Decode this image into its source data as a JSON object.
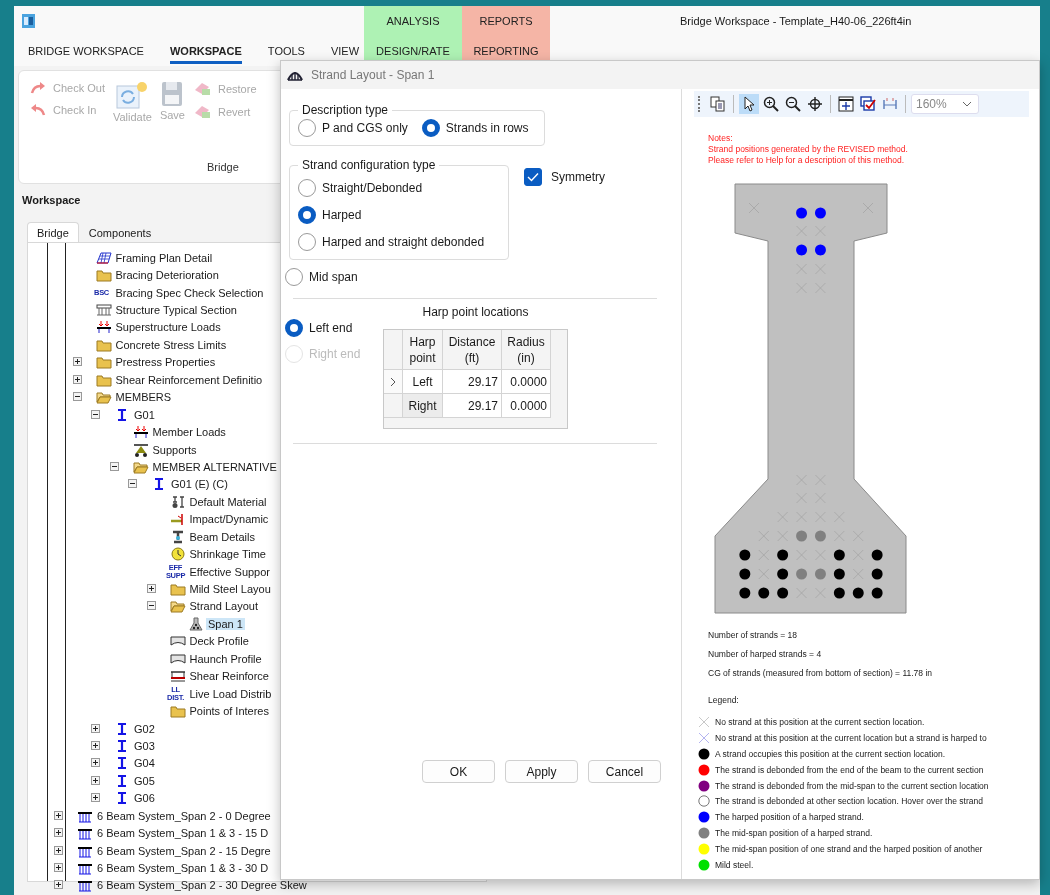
{
  "app": {
    "title": "Bridge Workspace - Template_H40-06_226ft4in"
  },
  "context_tabs": [
    {
      "group": "ANALYSIS",
      "label": "DESIGN/RATE",
      "color": "#aef2b4"
    },
    {
      "group": "REPORTS",
      "label": "REPORTING",
      "color": "#f5b5a6"
    }
  ],
  "menu": [
    {
      "label": "BRIDGE WORKSPACE",
      "selected": false
    },
    {
      "label": "WORKSPACE",
      "selected": true
    },
    {
      "label": "TOOLS",
      "selected": false
    },
    {
      "label": "VIEW",
      "selected": false
    }
  ],
  "ribbon": {
    "group_label": "Bridge",
    "columns": [
      {
        "kind": "stack",
        "buttons": [
          {
            "label": "Check Out",
            "kind": "redo",
            "disabled": true
          },
          {
            "label": "Check In",
            "kind": "undo",
            "disabled": true
          }
        ]
      },
      {
        "kind": "large",
        "buttons": [
          {
            "label": "Validate",
            "kind": "validate",
            "disabled": true
          }
        ]
      },
      {
        "kind": "large",
        "buttons": [
          {
            "label": "Save",
            "kind": "save",
            "disabled": true
          }
        ]
      },
      {
        "kind": "stack",
        "buttons": [
          {
            "label": "Restore",
            "kind": "eraser",
            "disabled": true
          },
          {
            "label": "Revert",
            "kind": "eraser",
            "disabled": true
          }
        ]
      }
    ]
  },
  "workspace": {
    "title": "Workspace",
    "tabs": [
      {
        "label": "Bridge",
        "selected": true
      },
      {
        "label": "Components",
        "selected": false
      }
    ],
    "tree": {
      "continued_items": [
        {
          "label": "Framing Plan Detail",
          "kind": "grid"
        },
        {
          "label": "Bracing Deterioration",
          "kind": "folder"
        },
        {
          "label": "Bracing Spec Check Selection",
          "kind": "badge",
          "badge": "BSC"
        },
        {
          "label": "Structure Typical Section",
          "kind": "section"
        },
        {
          "label": "Superstructure Loads",
          "kind": "loads"
        },
        {
          "label": "Concrete Stress Limits",
          "kind": "folder"
        },
        {
          "label": "Prestress Properties",
          "kind": "folder",
          "expanded": false
        },
        {
          "label": "Shear Reinforcement Definitio",
          "kind": "folder",
          "expanded": false
        },
        {
          "label": "MEMBERS",
          "kind": "folder",
          "expanded": true,
          "children": [
            {
              "label": "G01",
              "kind": "girder",
              "expanded": true,
              "children": [
                {
                  "label": "Member Loads",
                  "kind": "loads"
                },
                {
                  "label": "Supports",
                  "kind": "supports"
                },
                {
                  "label": "MEMBER ALTERNATIVE",
                  "kind": "folder",
                  "expanded": true,
                  "children": [
                    {
                      "label": "G01 (E)  (C)",
                      "kind": "girder",
                      "expanded": true,
                      "children": [
                        {
                          "label": "Default Material",
                          "kind": "material"
                        },
                        {
                          "label": "Impact/Dynamic",
                          "kind": "impact"
                        },
                        {
                          "label": "Beam Details",
                          "kind": "beam"
                        },
                        {
                          "label": "Shrinkage Time",
                          "kind": "clock"
                        },
                        {
                          "label": "Effective Suppor",
                          "kind": "badge",
                          "badge": "EFF SUPP"
                        },
                        {
                          "label": "Mild Steel Layou",
                          "kind": "folder",
                          "expanded": false
                        },
                        {
                          "label": "Strand Layout",
                          "kind": "folder",
                          "expanded": true,
                          "children": [
                            {
                              "label": "Span 1",
                              "kind": "strands",
                              "selected": true
                            }
                          ]
                        },
                        {
                          "label": "Deck Profile",
                          "kind": "profile"
                        },
                        {
                          "label": "Haunch Profile",
                          "kind": "profile"
                        },
                        {
                          "label": "Shear Reinforce",
                          "kind": "shear"
                        },
                        {
                          "label": "Live Load Distrib",
                          "kind": "badge",
                          "badge": "LL DIST."
                        },
                        {
                          "label": "Points of Interes",
                          "kind": "folder"
                        }
                      ]
                    }
                  ]
                }
              ]
            },
            {
              "label": "G02",
              "kind": "girder",
              "expanded": false
            },
            {
              "label": "G03",
              "kind": "girder",
              "expanded": false
            },
            {
              "label": "G04",
              "kind": "girder",
              "expanded": false
            },
            {
              "label": "G05",
              "kind": "girder",
              "expanded": false
            },
            {
              "label": "G06",
              "kind": "girder",
              "expanded": false
            }
          ]
        }
      ],
      "items": [
        {
          "label": "6 Beam System_Span 2 - 0 Degree",
          "kind": "system",
          "expanded": false
        },
        {
          "label": "6 Beam System_Span 1 & 3 - 15 D",
          "kind": "system",
          "expanded": false
        },
        {
          "label": "6 Beam System_Span 2 - 15 Degre",
          "kind": "system",
          "expanded": false
        },
        {
          "label": "6 Beam System_Span 1 & 3 - 30 D",
          "kind": "system",
          "expanded": false
        },
        {
          "label": "6 Beam System_Span 2 - 30 Degree Skew",
          "kind": "system",
          "expanded": false
        }
      ]
    }
  },
  "dialog": {
    "title": "Strand Layout - Span 1",
    "description_type": {
      "legend": "Description type",
      "options": [
        {
          "label": "P and CGS only",
          "selected": false
        },
        {
          "label": "Strands in rows",
          "selected": true
        }
      ]
    },
    "config_type": {
      "legend": "Strand configuration type",
      "options": [
        {
          "label": "Straight/Debonded",
          "selected": false
        },
        {
          "label": "Harped",
          "selected": true
        },
        {
          "label": "Harped and straight debonded",
          "selected": false
        }
      ]
    },
    "symmetry": {
      "label": "Symmetry",
      "checked": true
    },
    "mid_span": {
      "label": "Mid span",
      "selected": false
    },
    "end_options": [
      {
        "label": "Left end",
        "selected": true,
        "disabled": false
      },
      {
        "label": "Right end",
        "selected": false,
        "disabled": true
      }
    ],
    "harp_table": {
      "title": "Harp point locations",
      "columns": [
        "Harp point",
        "Distance (ft)",
        "Radius (in)"
      ],
      "rows": [
        {
          "cells": [
            "Left",
            "29.17",
            "0.0000"
          ],
          "current": true,
          "highlighted": false
        },
        {
          "cells": [
            "Right",
            "29.17",
            "0.0000"
          ],
          "current": false,
          "highlighted": true
        }
      ]
    },
    "buttons": [
      "OK",
      "Apply",
      "Cancel"
    ],
    "viewer": {
      "tools": [
        {
          "kind": "copy",
          "selected": false
        },
        {
          "kind": "pointer",
          "selected": true
        },
        {
          "kind": "zoom-in",
          "selected": false
        },
        {
          "kind": "zoom-out",
          "selected": false
        },
        {
          "kind": "crosshair",
          "selected": false
        },
        {
          "kind": "fit",
          "selected": false
        },
        {
          "kind": "check",
          "selected": false
        },
        {
          "kind": "dimension",
          "selected": false
        }
      ],
      "zoom": "160%",
      "notes": [
        "Notes:",
        "Strand positions generated by the REVISED method.",
        "Please refer to Help for a description of this method."
      ],
      "section_rows": [
        {
          "groups": [
            [
              {
                "kind": "none"
              }
            ],
            [
              {
                "kind": "harped"
              },
              {
                "kind": "harped"
              }
            ],
            [
              {
                "kind": "none"
              }
            ]
          ]
        },
        {
          "groups": [
            [
              {
                "kind": "none"
              },
              {
                "kind": "none"
              }
            ]
          ]
        },
        {
          "groups": [
            [
              {
                "kind": "harped"
              },
              {
                "kind": "harped"
              }
            ]
          ]
        },
        {
          "groups": [
            [
              {
                "kind": "none"
              },
              {
                "kind": "none"
              }
            ]
          ]
        },
        {
          "groups": [
            [
              {
                "kind": "none"
              },
              {
                "kind": "none"
              }
            ]
          ]
        },
        {
          "groups": [
            [
              {
                "kind": "none"
              },
              {
                "kind": "none"
              }
            ]
          ]
        },
        {
          "groups": [
            [
              {
                "kind": "none"
              },
              {
                "kind": "none"
              }
            ]
          ]
        },
        {
          "groups": [
            [
              {
                "kind": "none"
              },
              {
                "kind": "none"
              },
              {
                "kind": "none"
              },
              {
                "kind": "none"
              }
            ]
          ]
        },
        {
          "groups": [
            [
              {
                "kind": "none"
              },
              {
                "kind": "none"
              },
              {
                "kind": "midspan"
              },
              {
                "kind": "midspan"
              },
              {
                "kind": "none"
              },
              {
                "kind": "none"
              }
            ]
          ]
        },
        {
          "groups": [
            [
              {
                "kind": "strand"
              },
              {
                "kind": "none"
              },
              {
                "kind": "strand"
              },
              {
                "kind": "none"
              },
              {
                "kind": "none"
              },
              {
                "kind": "strand"
              },
              {
                "kind": "none"
              },
              {
                "kind": "strand"
              }
            ]
          ]
        },
        {
          "groups": [
            [
              {
                "kind": "strand"
              },
              {
                "kind": "none"
              },
              {
                "kind": "strand"
              },
              {
                "kind": "midspan"
              },
              {
                "kind": "midspan"
              },
              {
                "kind": "strand"
              },
              {
                "kind": "none"
              },
              {
                "kind": "strand"
              }
            ]
          ]
        },
        {
          "groups": [
            [
              {
                "kind": "strand"
              },
              {
                "kind": "strand"
              },
              {
                "kind": "strand"
              },
              {
                "kind": "none"
              },
              {
                "kind": "none"
              },
              {
                "kind": "strand"
              },
              {
                "kind": "strand"
              },
              {
                "kind": "strand"
              }
            ]
          ]
        }
      ],
      "stats": [
        "Number of strands = 18",
        "Number of harped strands = 4",
        "CG of strands (measured from bottom of section) = 11.78 in"
      ],
      "legend_title": "Legend:",
      "legend": [
        {
          "kind": "cross",
          "color": "#c8c8c8",
          "text": "No strand at this position at the current section location."
        },
        {
          "kind": "cross",
          "color": "#b4b4f0",
          "text": "No strand at this position at the current location but a strand is harped to"
        },
        {
          "kind": "dot",
          "color": "#000000",
          "text": "A strand occupies this position at the current section location."
        },
        {
          "kind": "dot",
          "color": "#ff0000",
          "text": "The strand is debonded from the end of the beam to the current section"
        },
        {
          "kind": "dot",
          "color": "#800080",
          "text": "The strand is debonded from the mid-span to the current section location"
        },
        {
          "kind": "ring",
          "color": "#ffffff",
          "text": "The strand is debonded at other section location. Hover over the strand"
        },
        {
          "kind": "dot",
          "color": "#0000ff",
          "text": "The harped position of a harped strand."
        },
        {
          "kind": "dot",
          "color": "#808080",
          "text": "The mid-span position of a harped strand."
        },
        {
          "kind": "dot",
          "color": "#ffff00",
          "text": "The mid-span position of one strand and the harped position of another"
        },
        {
          "kind": "dot",
          "color": "#00e000",
          "text": "Mild steel."
        }
      ]
    }
  }
}
